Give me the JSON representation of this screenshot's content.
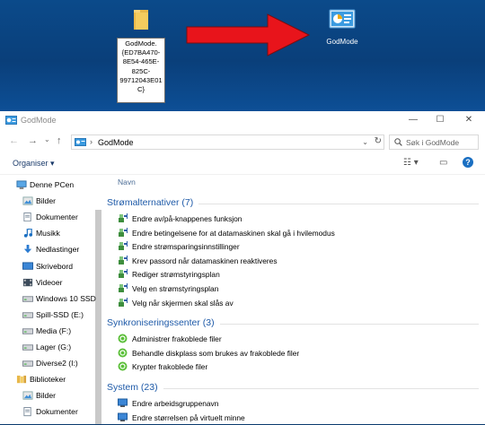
{
  "desktop": {
    "rename_lines": [
      "GodMode.",
      "{ED7BA470-",
      "8E54-465E-",
      "825C-",
      "99712043E01",
      "C}"
    ],
    "godmode_label": "GodMode"
  },
  "window": {
    "title": "GodMode",
    "minimize": "—",
    "maximize": "☐",
    "close": "✕"
  },
  "address": {
    "back": "←",
    "forward": "→",
    "dropdown": "⌄",
    "up": "↑",
    "separator": "›",
    "path": "GodMode",
    "search_placeholder": "Søk i GodMode"
  },
  "toolbar": {
    "organise": "Organiser ▾",
    "view": "☷ ▾",
    "pane": "▭",
    "help": "?"
  },
  "nav": {
    "items": [
      {
        "label": "Denne PCen",
        "icon": "computer-icon",
        "level": 0
      },
      {
        "label": "Bilder",
        "icon": "pictures-icon",
        "level": 1
      },
      {
        "label": "Dokumenter",
        "icon": "documents-icon",
        "level": 1
      },
      {
        "label": "Musikk",
        "icon": "music-icon",
        "level": 1
      },
      {
        "label": "Nedlastinger",
        "icon": "downloads-icon",
        "level": 1
      },
      {
        "label": "Skrivebord",
        "icon": "desktop-icon",
        "level": 1
      },
      {
        "label": "Videoer",
        "icon": "videos-icon",
        "level": 1
      },
      {
        "label": "Windows 10 SSD",
        "icon": "drive-icon",
        "level": 1
      },
      {
        "label": "Spill-SSD (E:)",
        "icon": "drive-icon",
        "level": 1
      },
      {
        "label": "Media (F:)",
        "icon": "drive-icon",
        "level": 1
      },
      {
        "label": "Lager (G:)",
        "icon": "drive-icon",
        "level": 1
      },
      {
        "label": "Diverse2 (I:)",
        "icon": "drive-icon",
        "level": 1
      },
      {
        "label": "Biblioteker",
        "icon": "libraries-icon",
        "level": 0
      },
      {
        "label": "Bilder",
        "icon": "pictures-icon",
        "level": 1
      },
      {
        "label": "Dokumenter",
        "icon": "documents-icon",
        "level": 1
      }
    ]
  },
  "content": {
    "column_name": "Navn",
    "groups": [
      {
        "title": "Strømalternativer (7)",
        "icon": "power-options-icon",
        "items": [
          "Endre av/på-knappenes funksjon",
          "Endre betingelsene for at datamaskinen skal gå i hvilemodus",
          "Endre strømsparingsinnstillinger",
          "Krev passord når datamaskinen reaktiveres",
          "Rediger strømstyringsplan",
          "Velg en strømstyringsplan",
          "Velg når skjermen skal slås av"
        ]
      },
      {
        "title": "Synkroniseringssenter (3)",
        "icon": "sync-center-icon",
        "items": [
          "Administrer frakoblede filer",
          "Behandle diskplass som brukes av frakoblede filer",
          "Krypter frakoblede filer"
        ]
      },
      {
        "title": "System (23)",
        "icon": "system-icon",
        "items": [
          "Endre arbeidsgruppenavn",
          "Endre størrelsen på virtuelt minne"
        ]
      }
    ]
  },
  "colors": {
    "desktop": "#0b4a8a",
    "arrow": "#e8141b",
    "group_header": "#1e5aa8",
    "nav_scroll": "#c9c9c9"
  }
}
